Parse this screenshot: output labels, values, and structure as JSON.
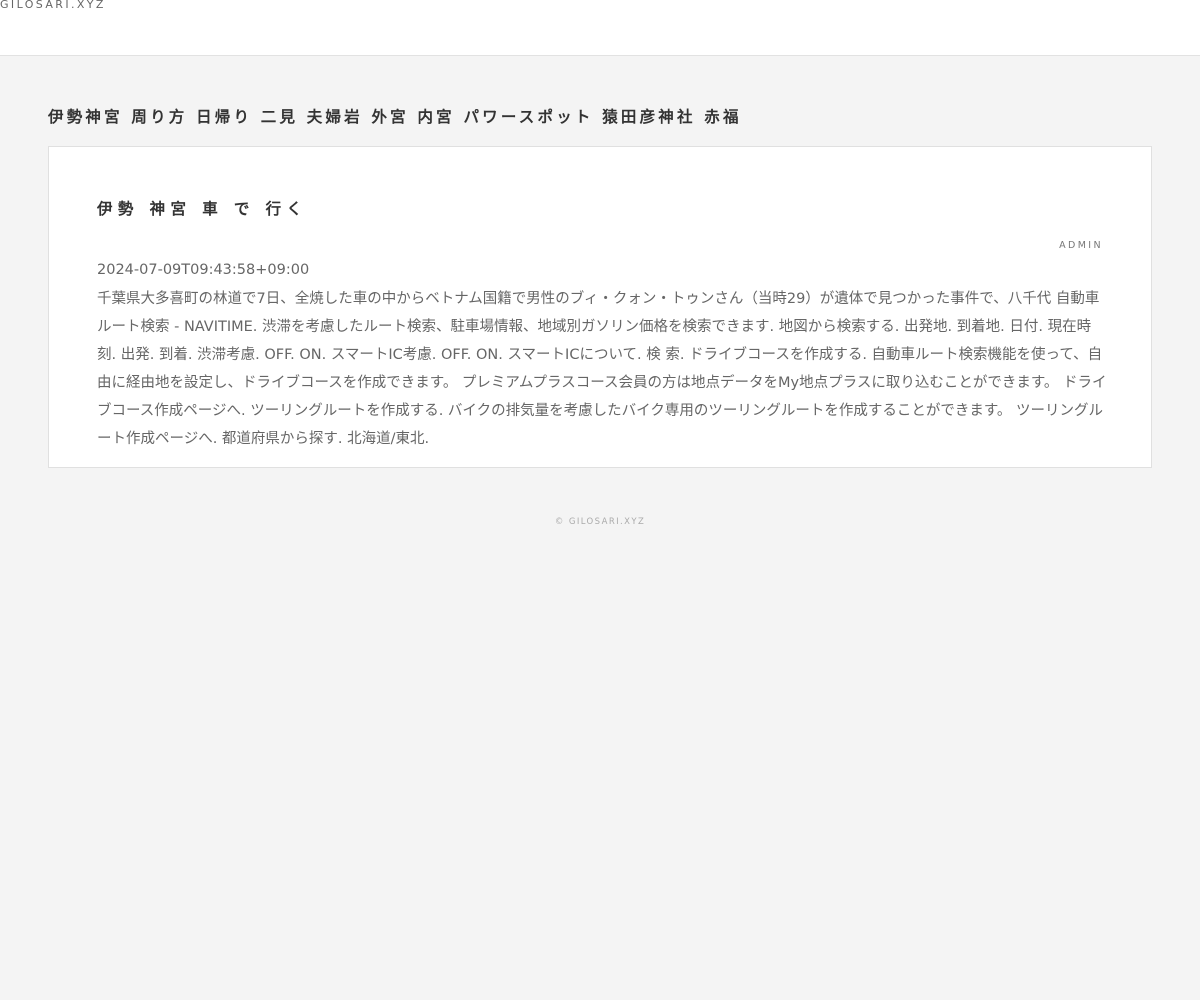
{
  "header": {
    "site_name": "GILOSARI.XYZ"
  },
  "section": {
    "title": "伊勢神宮 周り方 日帰り 二見 夫婦岩 外宮 内宮 パワースポット 猿田彦神社 赤福"
  },
  "post": {
    "title": "伊勢 神宮 車 で 行く",
    "author": "ADMIN",
    "date": "2024-07-09T09:43:58+09:00",
    "body": "千葉県大多喜町の林道で7日、全焼した車の中からベトナム国籍で男性のブィ・クォン・トゥンさん（当時29）が遺体で見つかった事件で、八千代 自動車ルート検索 - NAVITIME. 渋滞を考慮したルート検索、駐車場情報、地域別ガソリン価格を検索できます. 地図から検索する. 出発地. 到着地. 日付. 現在時刻. 出発. 到着. 渋滞考慮. OFF. ON. スマートIC考慮. OFF. ON. スマートICについて. 検 索. ドライブコースを作成する. 自動車ルート検索機能を使って、自由に経由地を設定し、ドライブコースを作成できます。 プレミアムプラスコース会員の方は地点データをMy地点プラスに取り込むことができます。 ドライブコース作成ページへ. ツーリングルートを作成する. バイクの排気量を考慮したバイク専用のツーリングルートを作成することができます。 ツーリングルート作成ページへ. 都道府県から探す. 北海道/東北."
  },
  "footer": {
    "copyright": "© GILOSARI.XYZ"
  }
}
